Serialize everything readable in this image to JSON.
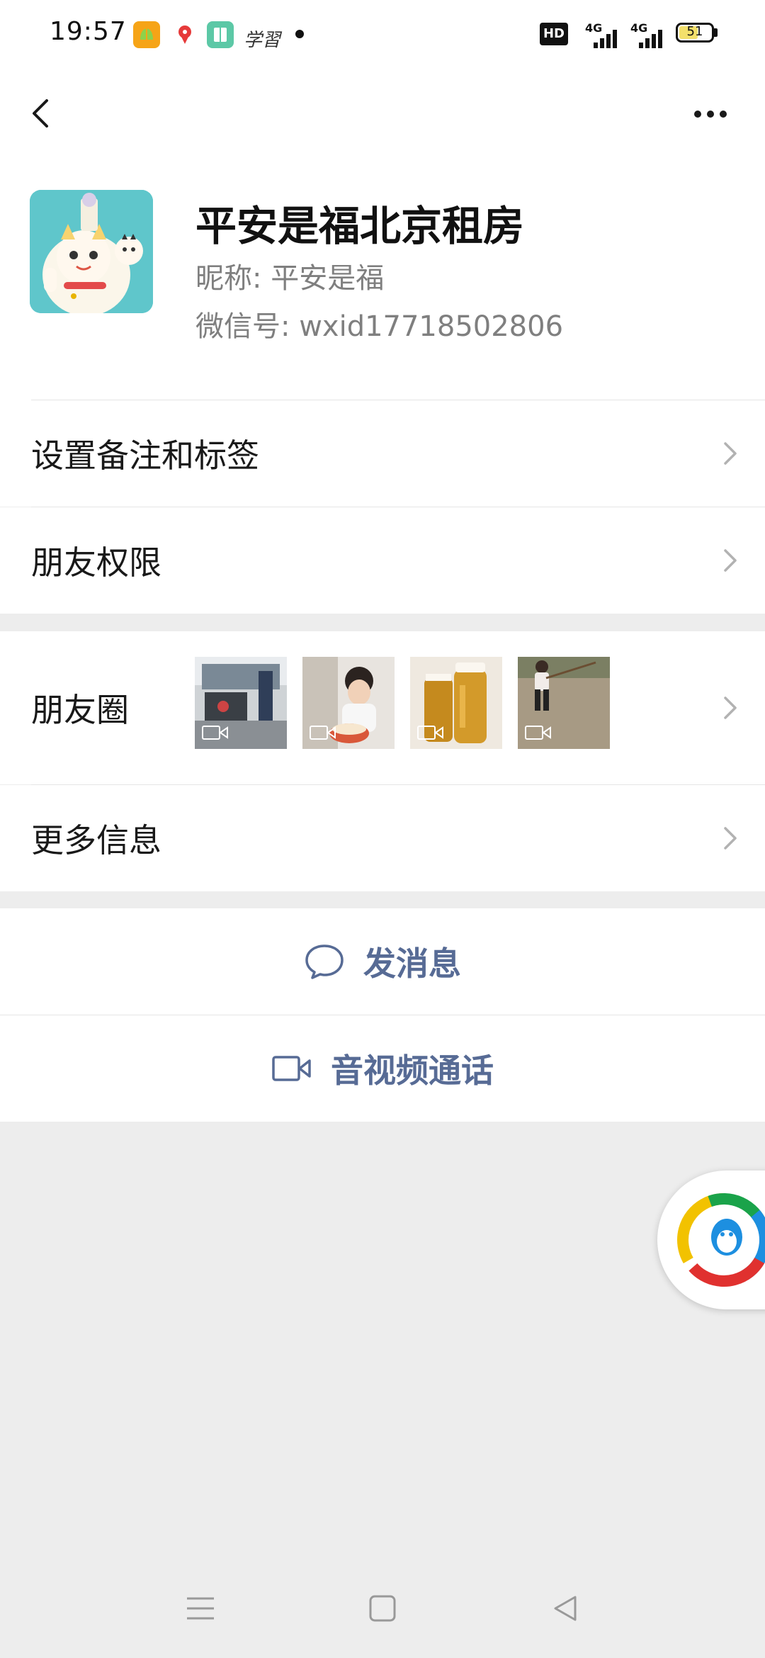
{
  "status_bar": {
    "time": "19:57",
    "notification_icons": [
      "notes-app-icon",
      "map-pin-app-icon",
      "book-app-icon"
    ],
    "notification_text_icon": "学習",
    "hd_badge": "HD",
    "network_1": "4G",
    "network_2": "4G",
    "battery_level": "51"
  },
  "header": {
    "back_icon": "chevron-left-icon",
    "more_icon": "more-dots-icon",
    "display_name": "平安是福北京租房",
    "nickname": "昵称: 平安是福",
    "wechat_id": "微信号: wxid17718502806"
  },
  "rows": {
    "remarks_tags": "设置备注和标签",
    "friend_permissions": "朋友权限",
    "moments": "朋友圈",
    "more_info": "更多信息"
  },
  "moments_thumbnails": [
    {
      "type": "video",
      "scene": "waiting hall"
    },
    {
      "type": "video",
      "scene": "birthday cake"
    },
    {
      "type": "video",
      "scene": "honey jars"
    },
    {
      "type": "video",
      "scene": "child outdoors"
    }
  ],
  "actions": {
    "send_message": "发消息",
    "video_call": "音视频通话"
  },
  "colors": {
    "link_blue": "#576b95",
    "background": "#ededed",
    "surface": "#ffffff"
  }
}
